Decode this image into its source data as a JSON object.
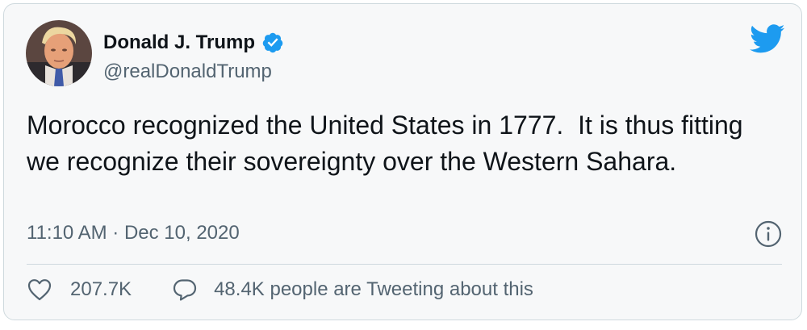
{
  "author": {
    "name": "Donald J. Trump",
    "handle": "@realDonaldTrump",
    "verified": true,
    "avatar_icon": "profile-photo"
  },
  "tweet": {
    "text": "Morocco recognized the United States in 1777.  It is thus fitting we recognize their sovereignty over the Western Sahara.",
    "timestamp": "11:10 AM · Dec 10, 2020"
  },
  "engagement": {
    "likes": "207.7K",
    "replies_text": "48.4K people are Tweeting about this"
  },
  "icons": {
    "brand": "twitter-bird-icon",
    "verified": "verified-badge-icon",
    "info": "info-icon",
    "like": "heart-icon",
    "reply": "speech-bubble-icon"
  },
  "colors": {
    "brand_blue": "#1d9bf0",
    "text_primary": "#0f1419",
    "text_secondary": "#536471",
    "card_background": "#f7f8f9",
    "border": "#cfd9de"
  }
}
